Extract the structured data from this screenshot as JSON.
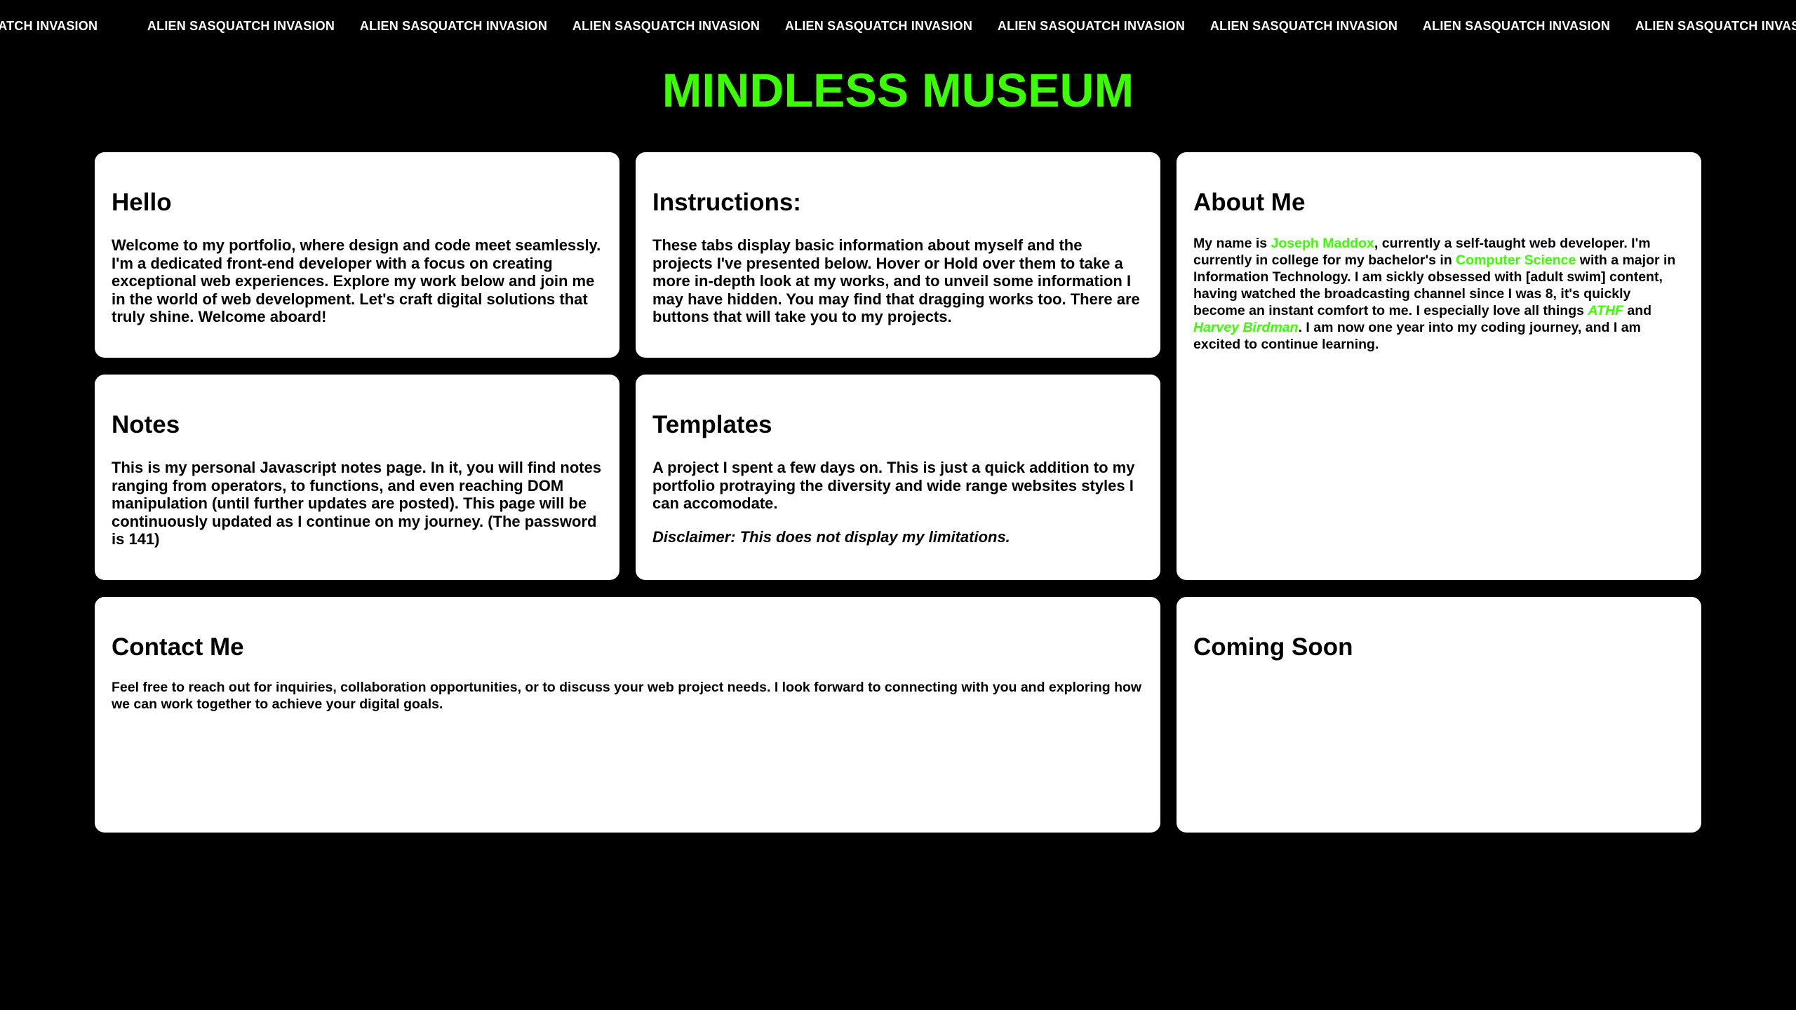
{
  "ticker": {
    "text": "ALIEN SASQUATCH INVASION",
    "items": [
      "ALIEN SASQUATCH INVASION",
      "ALIEN SASQUATCH INVASION",
      "ALIEN SASQUATCH INVASION",
      "ALIEN SASQUATCH INVASION",
      "ALIEN SASQUATCH INVASION",
      "ALIEN SASQUATCH INVASION",
      "ALIEN SASQUATCH INVASION",
      "ALIEN SASQUATCH INVASION",
      "ALIEN SASQUATCH INVASION"
    ]
  },
  "header": {
    "title": "MINDLESS MUSEUM",
    "title_color": "#3bff00"
  },
  "cards": {
    "hello": {
      "title": "Hello",
      "body": "Welcome to my portfolio, where design and code meet seamlessly. I'm a dedicated front-end developer with a focus on creating exceptional web experiences. Explore my work below and join me in the world of web development. Let's craft digital solutions that truly shine. Welcome aboard!"
    },
    "instructions": {
      "title": "Instructions:",
      "body": "These tabs display basic information about myself and the projects I've presented below. Hover or Hold over them to take a more in-depth look at my works, and to unveil some information I may have hidden. You may find that dragging works too. There are buttons that will take you to my projects."
    },
    "about": {
      "title": "About Me",
      "seg1": "My name is ",
      "name": "Joseph Maddox",
      "seg2": ", currently a self-taught web developer. I'm currently in college for my bachelor's in ",
      "degree": "Computer Science",
      "seg3": " with a major in Information Technology. I am sickly obsessed with [adult swim] content, having watched the broadcasting channel since I was 8, it's quickly become an instant comfort to me. I especially love all things ",
      "show1": "ATHF",
      "seg4": " and ",
      "show2": "Harvey Birdman",
      "seg5": ". I am now one year into my coding journey, and I am excited to continue learning."
    },
    "notes": {
      "title": "Notes",
      "body": "This is my personal Javascript notes page. In it, you will find notes ranging from operators, to functions, and even reaching DOM manipulation (until further updates are posted). This page will be continuously updated as I continue on my journey. (The password is 141)"
    },
    "templates": {
      "title": "Templates",
      "body": "A project I spent a few days on. This is just a quick addition to my portfolio protraying the diversity and wide range websites styles I can accomodate.",
      "disclaimer": "Disclaimer: This does not display my limitations."
    },
    "contact": {
      "title": "Contact Me",
      "body": "Feel free to reach out for inquiries, collaboration opportunities, or to discuss your web project needs. I look forward to connecting with you and exploring how we can work together to achieve your digital goals."
    },
    "coming": {
      "title": "Coming Soon"
    }
  },
  "colors": {
    "background": "#000000",
    "card": "#ffffff",
    "accent": "#3bff00"
  }
}
